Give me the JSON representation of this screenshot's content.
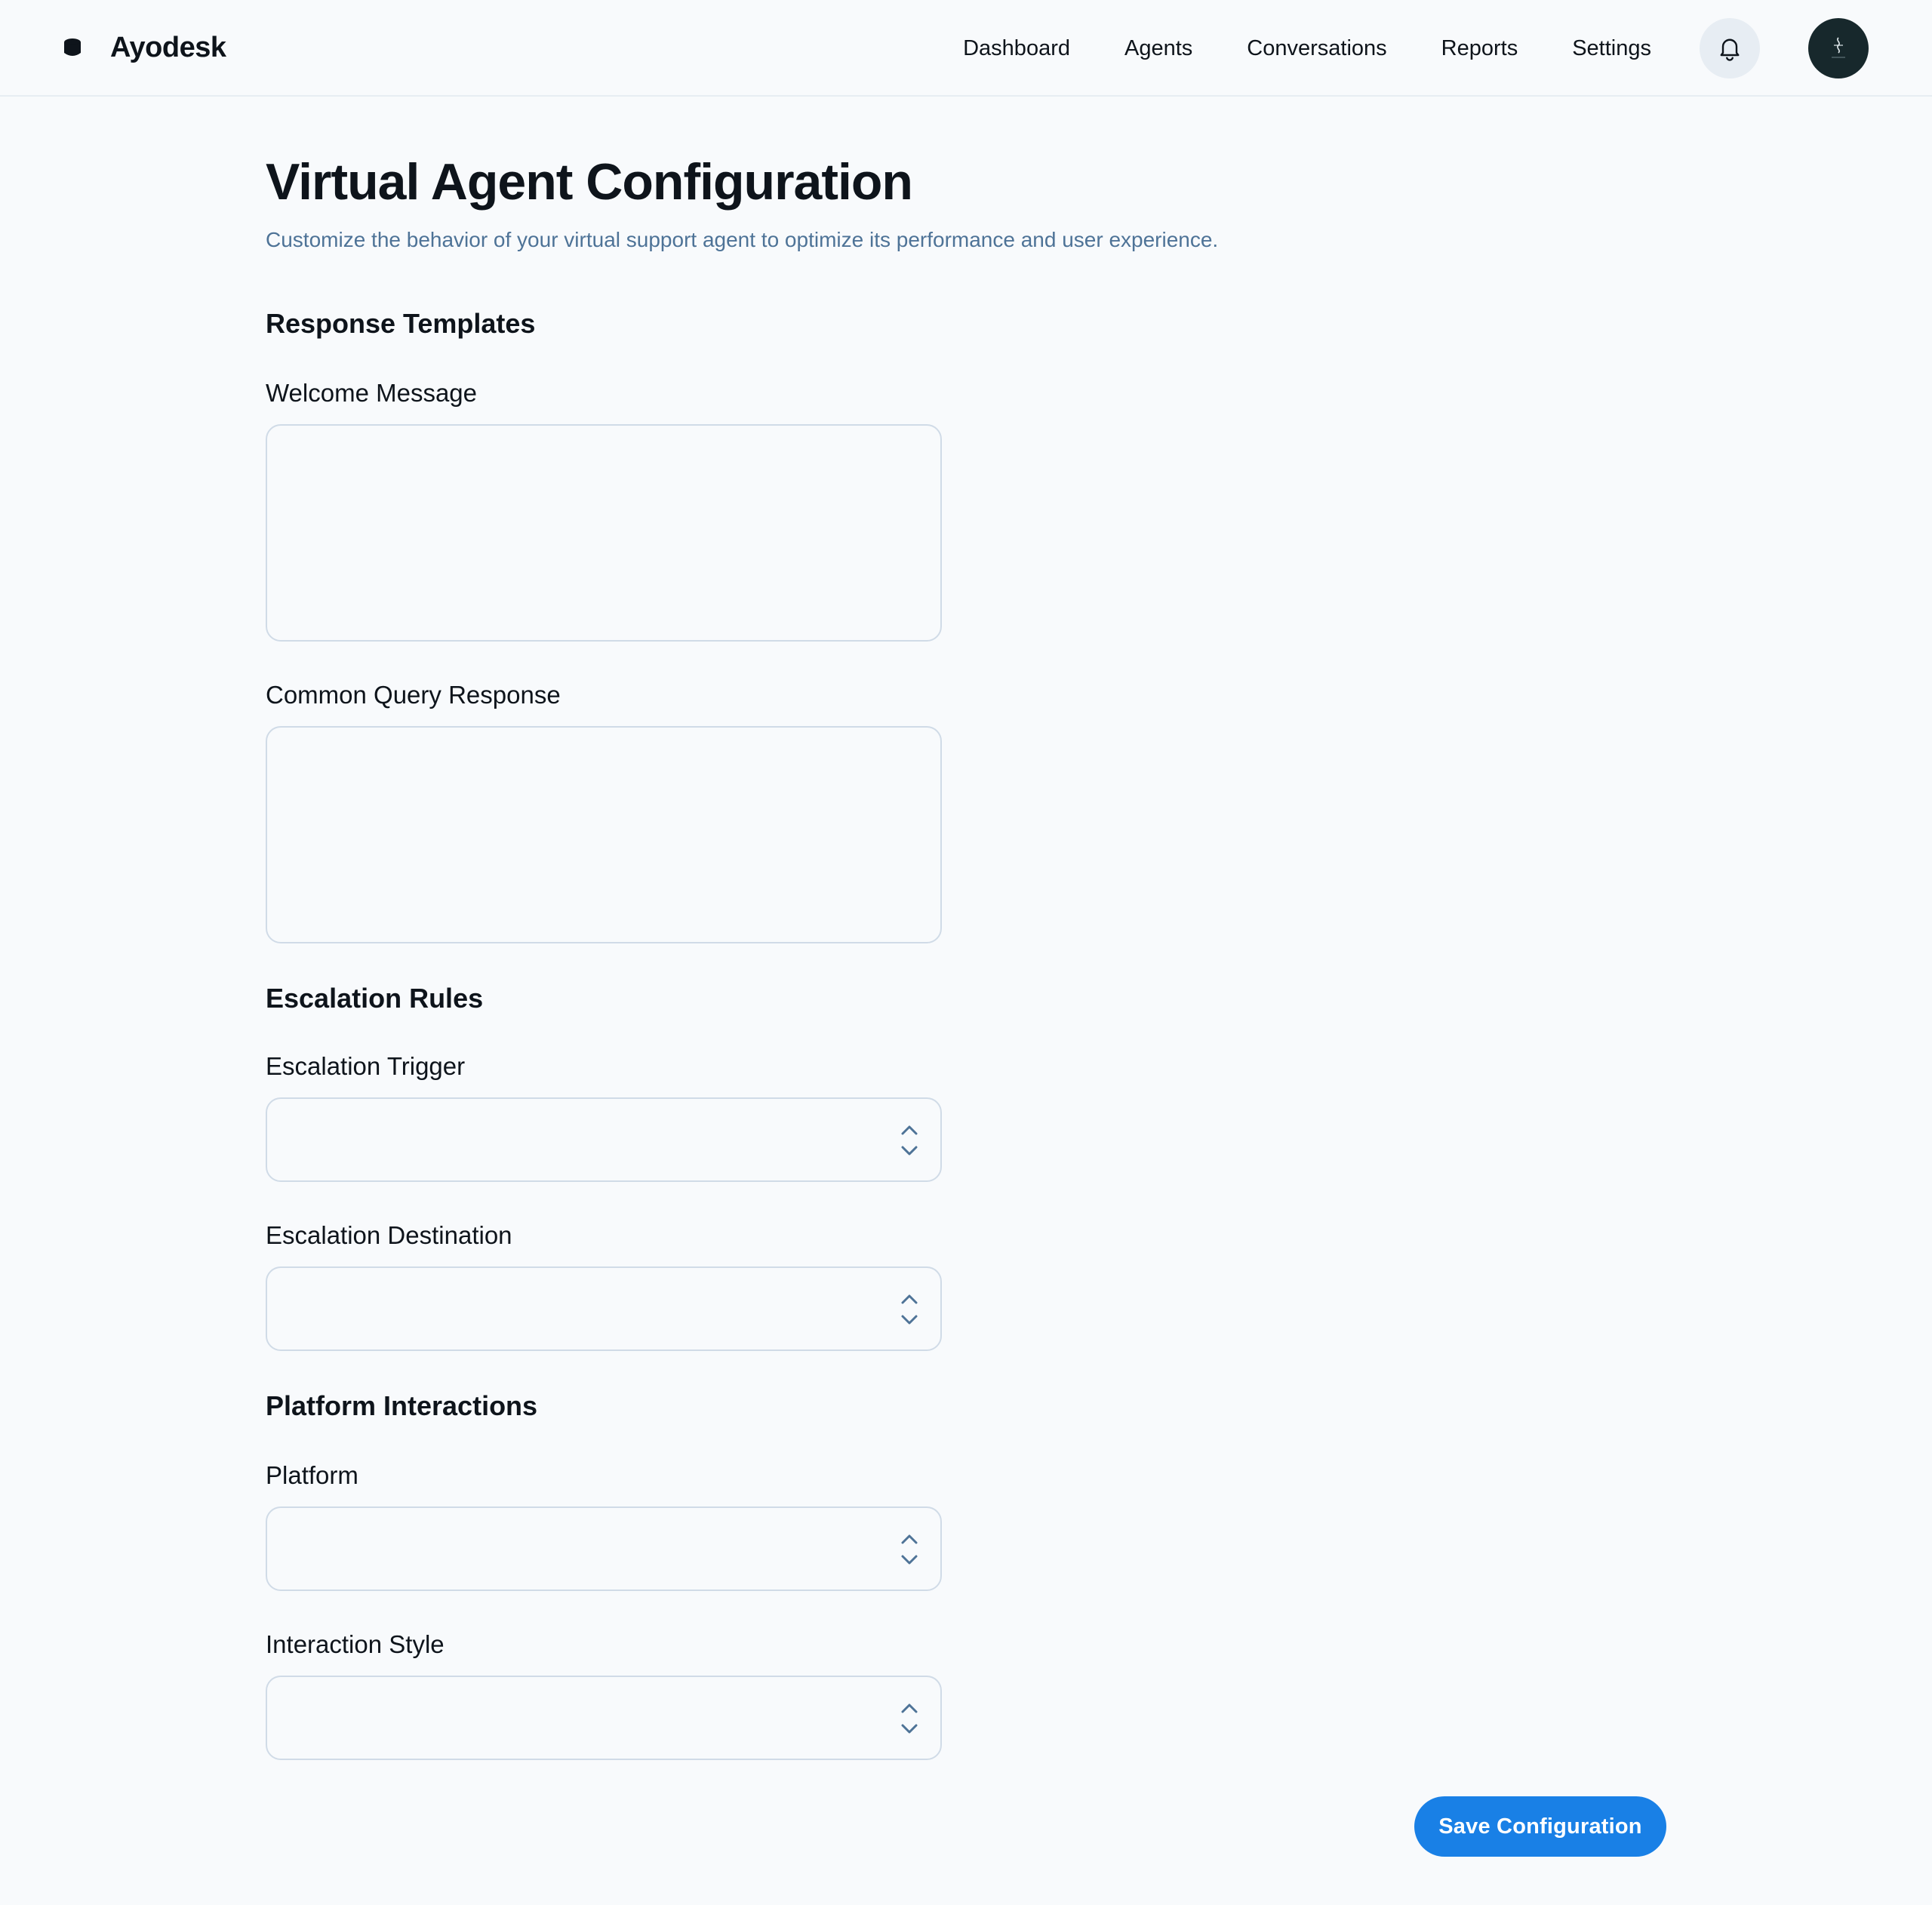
{
  "header": {
    "brand": "Ayodesk",
    "nav": [
      "Dashboard",
      "Agents",
      "Conversations",
      "Reports",
      "Settings"
    ],
    "icons": {
      "brand": "cube-icon",
      "notifications": "bell-icon",
      "avatar": "user-avatar"
    }
  },
  "page": {
    "title": "Virtual Agent Configuration",
    "subtitle": "Customize the behavior of your virtual support agent to optimize its performance and user experience."
  },
  "sections": {
    "response_templates": {
      "title": "Response Templates",
      "welcome_label": "Welcome Message",
      "welcome_value": "",
      "common_query_label": "Common Query Response",
      "common_query_value": ""
    },
    "escalation_rules": {
      "title": "Escalation Rules",
      "trigger_label": "Escalation Trigger",
      "trigger_value": "",
      "destination_label": "Escalation Destination",
      "destination_value": ""
    },
    "platform_interactions": {
      "title": "Platform Interactions",
      "platform_label": "Platform",
      "platform_value": "",
      "style_label": "Interaction Style",
      "style_value": ""
    }
  },
  "actions": {
    "save_label": "Save Configuration"
  },
  "colors": {
    "primary": "#1980e6",
    "subtitle": "#4e7397",
    "border": "#d0dbe7",
    "background": "#f8fafc",
    "text": "#0e141b"
  }
}
